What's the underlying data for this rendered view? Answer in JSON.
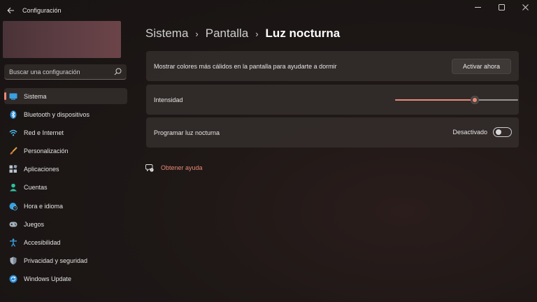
{
  "window": {
    "title": "Configuración",
    "back_icon": "back-arrow-icon",
    "controls": [
      "minimize-icon",
      "maximize-icon",
      "close-icon"
    ]
  },
  "sidebar": {
    "search": {
      "placeholder": "Buscar una configuración",
      "icon": "search-icon"
    },
    "items": [
      {
        "label": "Sistema",
        "icon": "monitor-icon",
        "active": true
      },
      {
        "label": "Bluetooth y dispositivos",
        "icon": "bluetooth-icon",
        "active": false
      },
      {
        "label": "Red e Internet",
        "icon": "wifi-icon",
        "active": false
      },
      {
        "label": "Personalización",
        "icon": "brush-icon",
        "active": false
      },
      {
        "label": "Aplicaciones",
        "icon": "apps-icon",
        "active": false
      },
      {
        "label": "Cuentas",
        "icon": "person-icon",
        "active": false
      },
      {
        "label": "Hora e idioma",
        "icon": "globe-clock-icon",
        "active": false
      },
      {
        "label": "Juegos",
        "icon": "gamepad-icon",
        "active": false
      },
      {
        "label": "Accesibilidad",
        "icon": "accessibility-icon",
        "active": false
      },
      {
        "label": "Privacidad y seguridad",
        "icon": "shield-icon",
        "active": false
      },
      {
        "label": "Windows Update",
        "icon": "update-icon",
        "active": false
      }
    ]
  },
  "main": {
    "breadcrumb": [
      "Sistema",
      "Pantalla",
      "Luz nocturna"
    ],
    "cards": {
      "warm_colors": {
        "label": "Mostrar colores más cálidos en la pantalla para ayudarte a dormir",
        "button_label": "Activar ahora"
      },
      "intensity": {
        "label": "Intensidad",
        "value_percent": 65
      },
      "schedule": {
        "label": "Programar luz nocturna",
        "toggle_state": "Desactivado",
        "toggle_on": false
      }
    },
    "help": {
      "label": "Obtener ayuda",
      "icon": "help-chat-icon"
    }
  },
  "colors": {
    "accent": "#e98a76",
    "card_bg": "#342e2d",
    "background": "#1d1716"
  }
}
